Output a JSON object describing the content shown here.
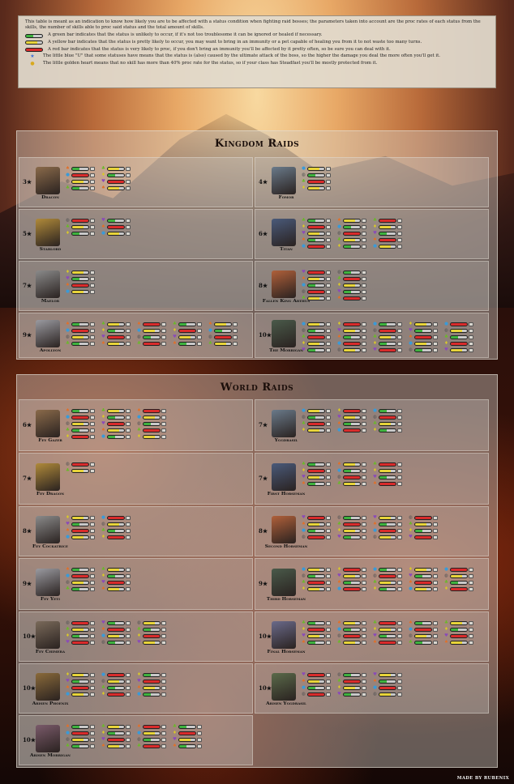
{
  "intro": {
    "text": "This table is meant as an indication to know how likely you are to be affected with a status condition when fighting raid bosses; the parameters taken into account are the proc rates of each status from the skills, the number of skills able to proc said status and the total amount of skills.",
    "legend": [
      {
        "kind": "green",
        "text": "A green bar indicates that the status is unlikely to occur, if it's not too troublesome it can be ignored or healed if necessary."
      },
      {
        "kind": "yellow",
        "text": "A yellow bar indicates that the status is pretty likely to occur, you may want to bring in an immunity or a pet capable of healing you from it to not waste too many turns."
      },
      {
        "kind": "red",
        "text": "A red bar indicates that the status is very likely to proc, if you don't bring an immunity you'll be affected by it pretty often, so be sure you can deal with it."
      },
      {
        "kind": "u",
        "text": "The little blue \"U\" that some statuses have means that the status is (also) caused by the ultimate attack of the boss, so the higher the damage you deal the more often you'll get it."
      },
      {
        "kind": "heart",
        "text": "The little golden heart means that no skill has more than 40% proc rate for the status, so if your class has Steadfast you'll be mostly protected from it."
      }
    ]
  },
  "kingdom": {
    "title": "Kingdom Raids",
    "bosses": [
      {
        "stars": "3★",
        "name": "Dracon"
      },
      {
        "stars": "4★",
        "name": "Fomor"
      },
      {
        "stars": "5★",
        "name": "Starlord"
      },
      {
        "stars": "6★",
        "name": "Titan"
      },
      {
        "stars": "7★",
        "name": "Maelor"
      },
      {
        "stars": "8★",
        "name": "Fallen King Arthus"
      },
      {
        "stars": "9★",
        "name": "Apollyon"
      },
      {
        "stars": "10★",
        "name": "The Morrigan"
      }
    ]
  },
  "world": {
    "title": "World Raids",
    "bosses": [
      {
        "stars": "6★",
        "name": "Fey Gazer"
      },
      {
        "stars": "7★",
        "name": "Yggdrasil"
      },
      {
        "stars": "7★",
        "name": "Fey Dragon"
      },
      {
        "stars": "7★",
        "name": "First Horseman"
      },
      {
        "stars": "8★",
        "name": "Fey Cockatrice"
      },
      {
        "stars": "8★",
        "name": "Second Horseman"
      },
      {
        "stars": "9★",
        "name": "Fey Yeti"
      },
      {
        "stars": "9★",
        "name": "Third Horseman"
      },
      {
        "stars": "10★",
        "name": "Fey Chimera"
      },
      {
        "stars": "10★",
        "name": "Final Horseman"
      },
      {
        "stars": "10★",
        "name": "Arisen Phoenix"
      },
      {
        "stars": "10★",
        "name": "Arisen Yggdrasil"
      },
      {
        "stars": "10★",
        "name": "Arisen Morrigan"
      }
    ]
  },
  "credit": "MADE BY RUBENIX",
  "colors": {
    "green": "#3fb23f",
    "yellow": "#e8d43a",
    "red": "#d92b2b"
  }
}
